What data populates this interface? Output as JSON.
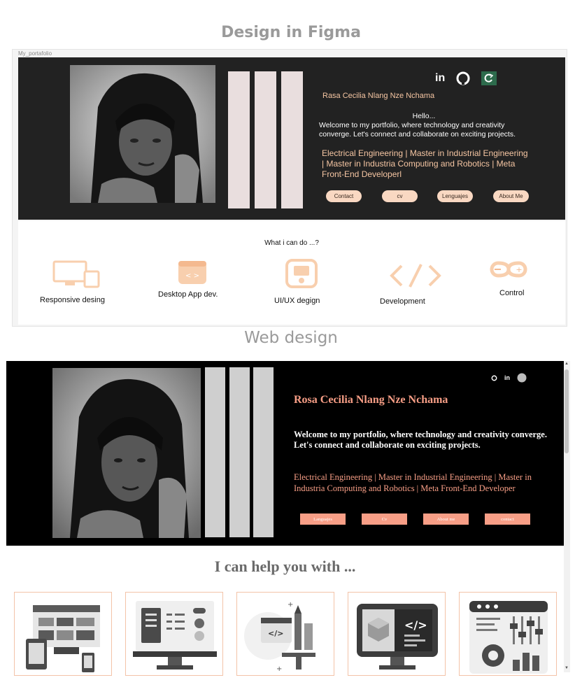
{
  "headings": {
    "figma": "Design in Figma",
    "web": "Web design"
  },
  "figma": {
    "frame_label": "My_portafolio",
    "social_icons": [
      "linkedin-icon",
      "github-icon",
      "refresh-icon"
    ],
    "linkedin_text": "in",
    "name": "Rasa  Cecilia Nlang Nze Nchama",
    "hello": "Hello...",
    "welcome": "Welcome to my portfolio, where technology and creativity converge. Let's connect and collaborate on exciting projects.",
    "roles": "Electrical Engineering | Master in Industrial Engineering | Master in Industria Computing and Robotics | Meta Front-End Developerl",
    "buttons": [
      "Contact",
      "cv",
      "Lenguajes",
      "About  Me"
    ],
    "what_title": "What i can do ...?",
    "services": [
      "Responsive desing",
      "Desktop App dev.",
      "UI/UX degign",
      "Development",
      "Control"
    ],
    "accent_color": "#f6c6a3"
  },
  "web": {
    "social_icons": [
      "github-icon",
      "linkedin-icon",
      "avatar-icon"
    ],
    "linkedin_text": "in",
    "name": "Rosa Cecilia Nlang Nze Nchama",
    "welcome": "Welcome to my portfolio, where technology and creativity converge. Let's connect and collaborate on exciting projects.",
    "roles": "Electrical Engineering | Master in Industrial Engineering | Master in Industria Computing and Robotics | Meta Front-End Developer",
    "buttons": [
      "Languajes",
      "Cv",
      "About me",
      "contact"
    ],
    "help_title": "I can help you with ...",
    "cards": [
      "responsive-devices-icon",
      "desktop-app-icon",
      "ui-design-icon",
      "development-icon",
      "control-settings-icon"
    ],
    "accent_color": "#f79e86"
  }
}
